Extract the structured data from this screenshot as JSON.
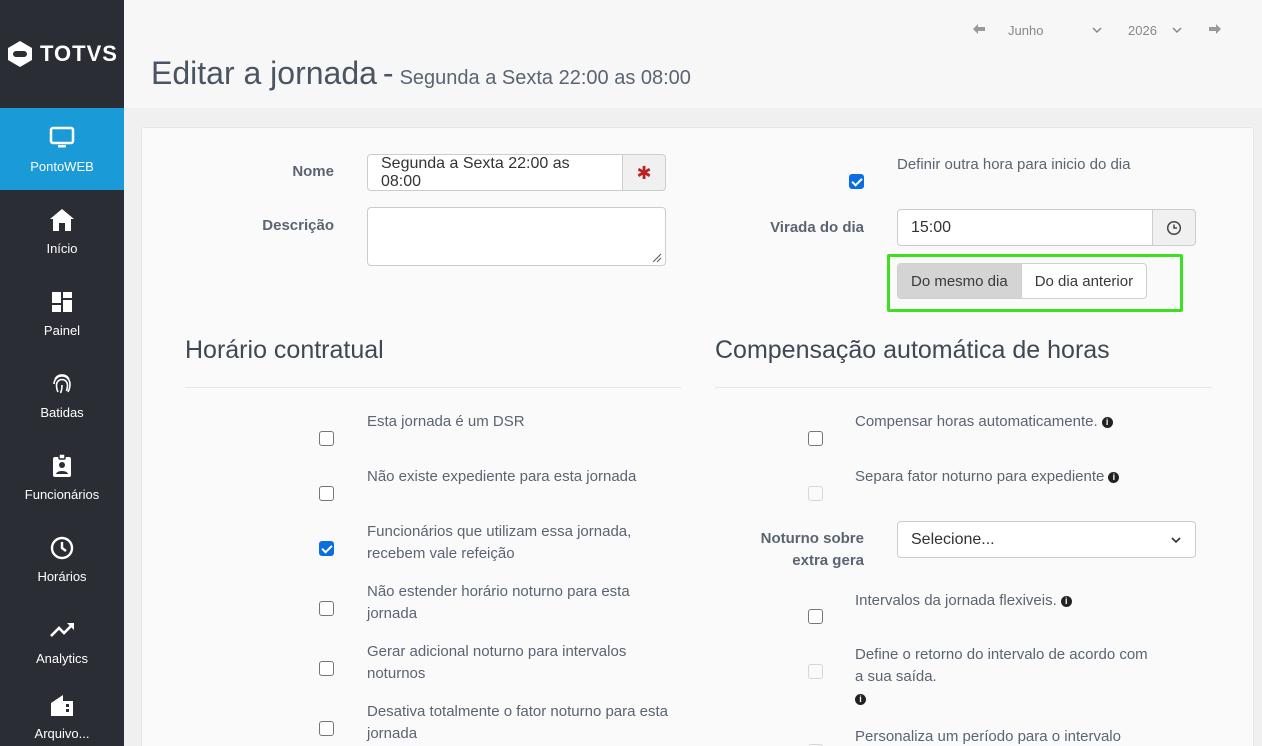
{
  "brand": {
    "logo_text": "TOTVS"
  },
  "sidebar": {
    "items": [
      {
        "label": "PontoWEB",
        "icon": "monitor-icon",
        "active": true
      },
      {
        "label": "Início",
        "icon": "home-icon"
      },
      {
        "label": "Painel",
        "icon": "dashboard-icon"
      },
      {
        "label": "Batidas",
        "icon": "fingerprint-icon"
      },
      {
        "label": "Funcionários",
        "icon": "badge-icon"
      },
      {
        "label": "Horários",
        "icon": "clock-icon"
      },
      {
        "label": "Analytics",
        "icon": "trending-up-icon"
      },
      {
        "label": "Arquivo...",
        "icon": "building-icon"
      }
    ]
  },
  "header": {
    "title": "Editar a jornada",
    "separator": "-",
    "subtitle": "Segunda a Sexta 22:00 as 08:00",
    "period": {
      "month": "Junho",
      "year": "2026"
    }
  },
  "form": {
    "name_label": "Nome",
    "name_value": "Segunda a Sexta 22:00 as 08:00",
    "description_label": "Descrição",
    "description_value": "",
    "define_start_label": "Definir outra hora para inicio do dia",
    "define_start_checked": true,
    "turnover_label": "Virada do dia",
    "turnover_value": "15:00",
    "day_options": [
      "Do mesmo dia",
      "Do dia anterior"
    ],
    "day_selected": "Do mesmo dia"
  },
  "contractual": {
    "title": "Horário contratual",
    "options": [
      {
        "label": "Esta jornada é um DSR",
        "checked": false
      },
      {
        "label": "Não existe expediente para esta jornada",
        "checked": false
      },
      {
        "label": "Funcionários que utilizam essa jornada, recebem vale refeição",
        "checked": true
      },
      {
        "label": "Não estender horário noturno para esta jornada",
        "checked": false
      },
      {
        "label": "Gerar adicional noturno para intervalos noturnos",
        "checked": false
      },
      {
        "label": "Desativa totalmente o fator noturno para esta jornada",
        "checked": false
      }
    ]
  },
  "compensation": {
    "title": "Compensação automática de horas",
    "auto_label": "Compensar horas automaticamente.",
    "night_factor_label": "Separa fator noturno para expediente",
    "night_extra_label": "Noturno sobre extra gera",
    "night_extra_value": "Selecione...",
    "flex_label": "Intervalos da jornada flexiveis.",
    "return_label": "Define o retorno do intervalo de acordo com a sua saída.",
    "custom_label": "Personaliza um período para o intervalo"
  }
}
